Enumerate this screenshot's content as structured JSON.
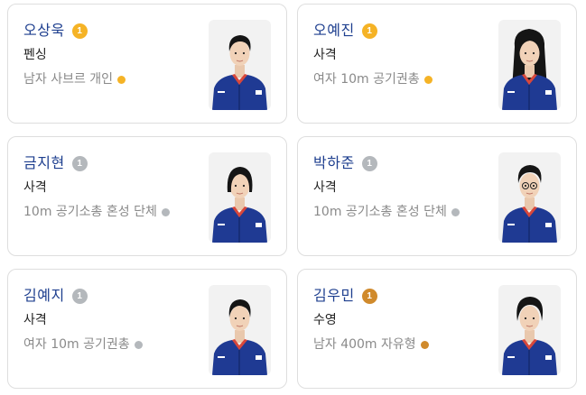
{
  "colors": {
    "gold": "#f5b326",
    "silver": "#b4b8bc",
    "bronze": "#d08a2c",
    "name_blue": "#1e3f8f",
    "jacket_blue": "#1f3a93"
  },
  "athletes": [
    {
      "name": "오상욱",
      "medal_number": "1",
      "medal": "gold",
      "sport": "펜싱",
      "event": "남자 사브르 개인",
      "hair": "short"
    },
    {
      "name": "오예진",
      "medal_number": "1",
      "medal": "gold",
      "sport": "사격",
      "event": "여자 10m 공기권총",
      "hair": "long"
    },
    {
      "name": "금지현",
      "medal_number": "1",
      "medal": "silver",
      "sport": "사격",
      "event": "10m 공기소총 혼성 단체",
      "hair": "bob"
    },
    {
      "name": "박하준",
      "medal_number": "1",
      "medal": "silver",
      "sport": "사격",
      "event": "10m 공기소총 혼성 단체",
      "hair": "glasses"
    },
    {
      "name": "김예지",
      "medal_number": "1",
      "medal": "silver",
      "sport": "사격",
      "event": "여자 10m 공기권총",
      "hair": "ponytail"
    },
    {
      "name": "김우민",
      "medal_number": "1",
      "medal": "bronze",
      "sport": "수영",
      "event": "남자 400m 자유형",
      "hair": "curly"
    }
  ]
}
